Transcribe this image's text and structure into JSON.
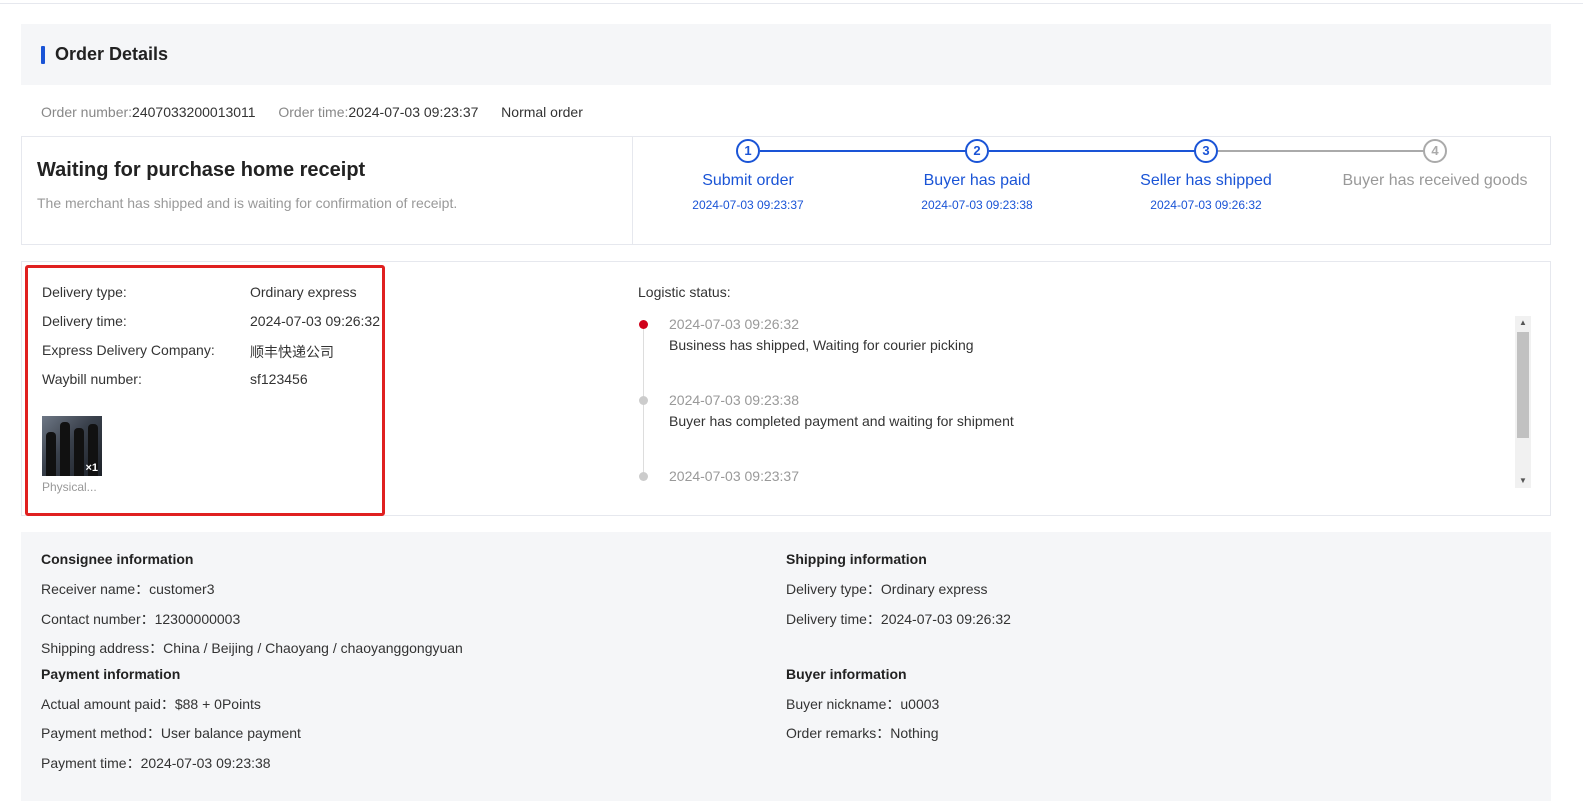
{
  "page": {
    "title": "Order Details"
  },
  "order_meta": {
    "number_label": "Order number:",
    "number_value": "2407033200013011",
    "time_label": "Order time:",
    "time_value": "2024-07-03 09:23:37",
    "type": "Normal order"
  },
  "status": {
    "title": "Waiting for purchase home receipt",
    "description": "The merchant has shipped and is waiting for confirmation of receipt."
  },
  "steps": [
    {
      "num": "1",
      "label": "Submit order",
      "time": "2024-07-03 09:23:37",
      "done": true
    },
    {
      "num": "2",
      "label": "Buyer has paid",
      "time": "2024-07-03 09:23:38",
      "done": true
    },
    {
      "num": "3",
      "label": "Seller has shipped",
      "time": "2024-07-03 09:26:32",
      "done": true
    },
    {
      "num": "4",
      "label": "Buyer has received goods",
      "time": "",
      "done": false
    }
  ],
  "delivery": {
    "type_label": "Delivery type:",
    "type_value": "Ordinary express",
    "time_label": "Delivery time:",
    "time_value": "2024-07-03 09:26:32",
    "company_label": "Express Delivery Company:",
    "company_value": "顺丰快递公司",
    "waybill_label": "Waybill number:",
    "waybill_value": "sf123456",
    "product_qty": "×1",
    "product_caption": "Physical..."
  },
  "logistics": {
    "title": "Logistic status:",
    "events": [
      {
        "time": "2024-07-03 09:26:32",
        "text": "Business has shipped, Waiting for courier picking",
        "active": true
      },
      {
        "time": "2024-07-03 09:23:38",
        "text": "Buyer has completed payment and waiting for shipment",
        "active": false
      },
      {
        "time": "2024-07-03 09:23:37",
        "text": "",
        "active": false
      }
    ]
  },
  "consignee": {
    "heading": "Consignee information",
    "receiver": "Receiver name：customer3",
    "contact": "Contact number：12300000003",
    "address": "Shipping address：China / Beijing / Chaoyang / chaoyanggongyuan"
  },
  "shipping": {
    "heading": "Shipping information",
    "type": "Delivery type：Ordinary express",
    "time": "Delivery time：2024-07-03 09:26:32"
  },
  "payment": {
    "heading": "Payment information",
    "amount": "Actual amount paid：$88 + 0Points",
    "method": "Payment method：User balance payment",
    "time": "Payment time：2024-07-03 09:23:38"
  },
  "buyer": {
    "heading": "Buyer information",
    "nickname": "Buyer nickname：u0003",
    "remarks": "Order remarks：Nothing"
  },
  "colors": {
    "accent": "#1a54d6",
    "highlight": "#e02020",
    "active_dot": "#d0021b"
  }
}
